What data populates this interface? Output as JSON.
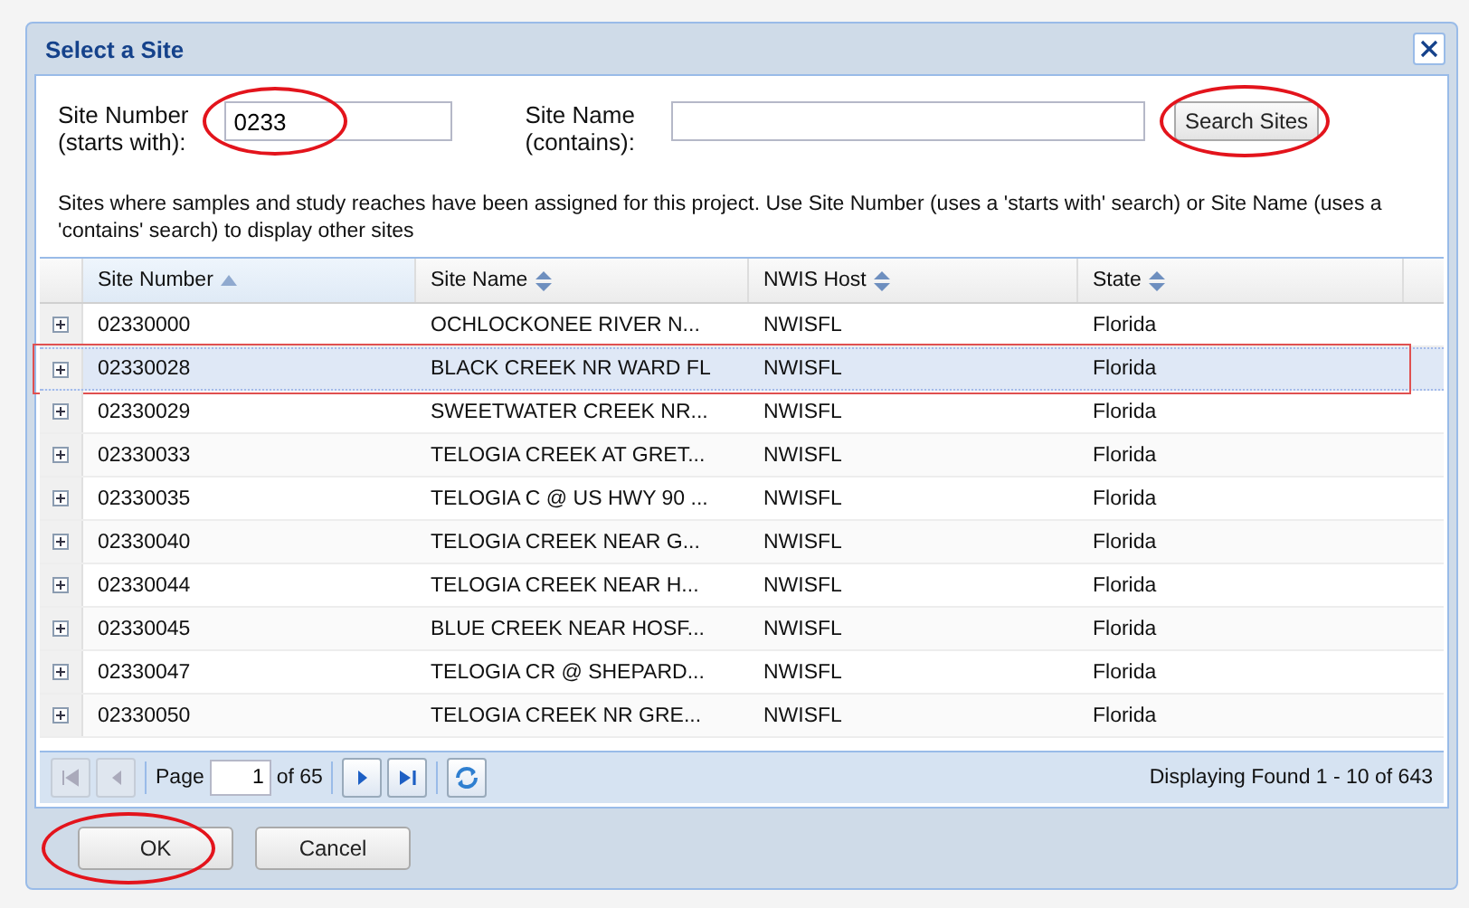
{
  "window": {
    "title": "Select a Site"
  },
  "site_number": {
    "label_line1": "Site Number",
    "label_line2": "(starts with):",
    "value": "0233",
    "circled": true
  },
  "site_name": {
    "label_line1": "Site Name",
    "label_line2": "(contains):"
  },
  "search_button": {
    "label": "Search Sites",
    "circled": true
  },
  "description": "Sites where samples and study reaches have been assigned for this project. Use Site Number (uses a 'starts with' search) or Site Name (uses a 'contains' search) to display other sites",
  "table": {
    "columns": [
      {
        "label": "Site Number",
        "sorted": true
      },
      {
        "label": "Site Name",
        "sorted": false
      },
      {
        "label": "NWIS Host",
        "sorted": false
      },
      {
        "label": "State",
        "sorted": false
      }
    ],
    "rows": [
      {
        "cells": [
          "02330000",
          "OCHLOCKONEE RIVER N...",
          "NWISFL",
          "Florida"
        ],
        "selected": false,
        "outlined": false
      },
      {
        "cells": [
          "02330028",
          "BLACK CREEK NR WARD FL",
          "NWISFL",
          "Florida"
        ],
        "selected": true,
        "outlined": true
      },
      {
        "cells": [
          "02330029",
          "SWEETWATER CREEK NR...",
          "NWISFL",
          "Florida"
        ],
        "selected": false,
        "outlined": false
      },
      {
        "cells": [
          "02330033",
          "TELOGIA CREEK AT GRET...",
          "NWISFL",
          "Florida"
        ],
        "selected": false,
        "outlined": false
      },
      {
        "cells": [
          "02330035",
          "TELOGIA C @ US HWY 90 ...",
          "NWISFL",
          "Florida"
        ],
        "selected": false,
        "outlined": false
      },
      {
        "cells": [
          "02330040",
          "TELOGIA CREEK NEAR G...",
          "NWISFL",
          "Florida"
        ],
        "selected": false,
        "outlined": false
      },
      {
        "cells": [
          "02330044",
          "TELOGIA CREEK NEAR H...",
          "NWISFL",
          "Florida"
        ],
        "selected": false,
        "outlined": false
      },
      {
        "cells": [
          "02330045",
          "BLUE CREEK NEAR HOSF...",
          "NWISFL",
          "Florida"
        ],
        "selected": false,
        "outlined": false
      },
      {
        "cells": [
          "02330047",
          "TELOGIA CR @ SHEPARD...",
          "NWISFL",
          "Florida"
        ],
        "selected": false,
        "outlined": false
      },
      {
        "cells": [
          "02330050",
          "TELOGIA CREEK NR GRE...",
          "NWISFL",
          "Florida"
        ],
        "selected": false,
        "outlined": false
      }
    ]
  },
  "pager": {
    "page_label": "Page",
    "page": "1",
    "of_label": "of 65",
    "display": "Displaying Found 1 - 10 of 643"
  },
  "buttons": [
    {
      "label": "OK",
      "circled": true
    },
    {
      "label": "Cancel",
      "circled": false
    }
  ]
}
